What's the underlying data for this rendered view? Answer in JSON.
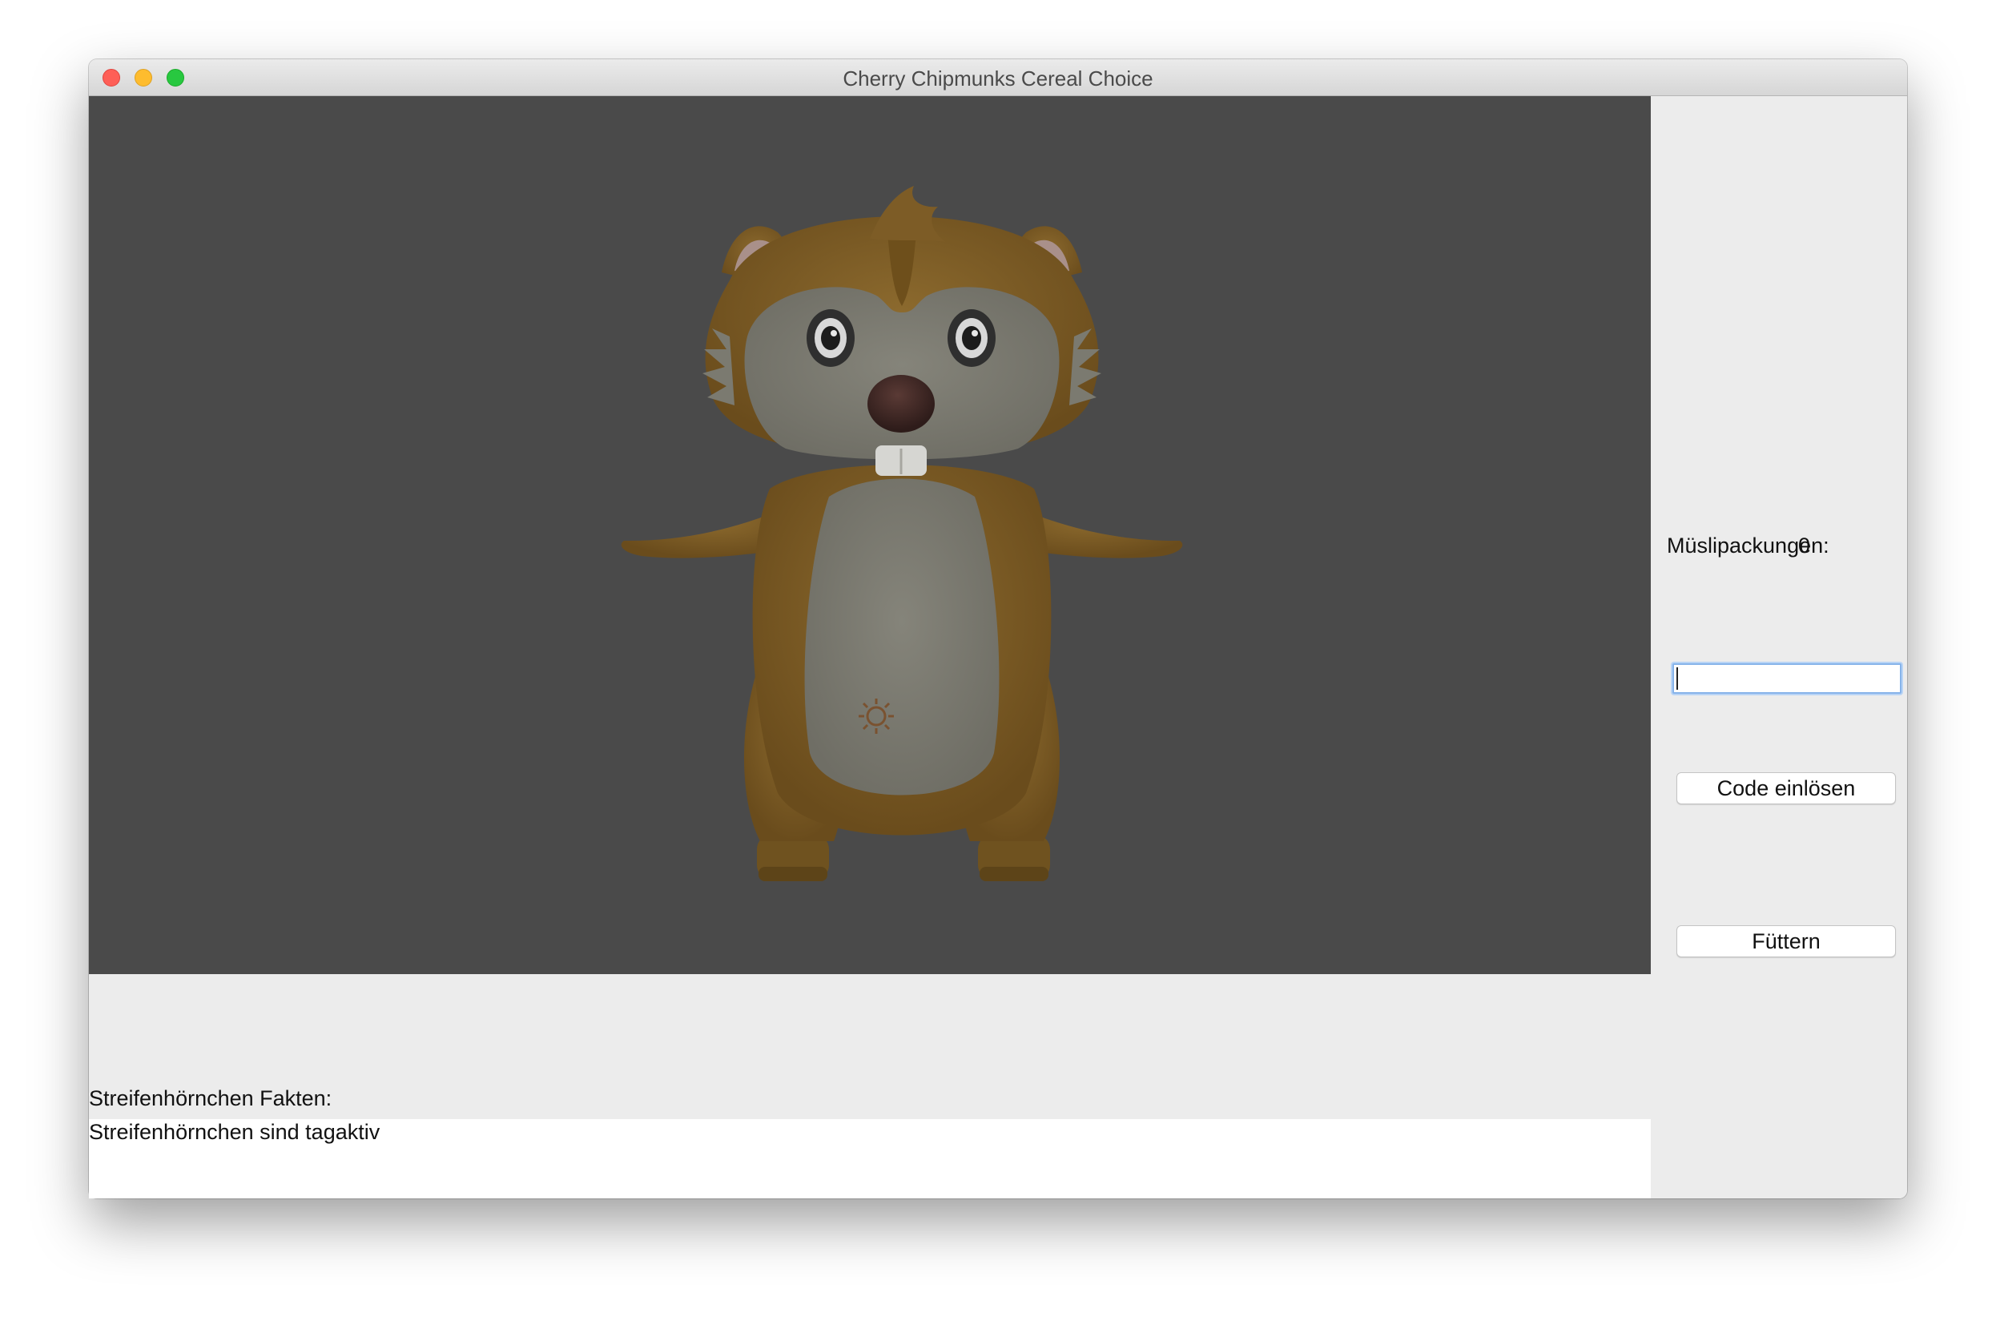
{
  "window": {
    "title": "Cherry Chipmunks Cereal Choice"
  },
  "sidebar": {
    "count_label": "Müslipackungen:",
    "count_value": "0",
    "code_input": {
      "value": "",
      "placeholder": ""
    },
    "redeem_button_label": "Code einlösen",
    "feed_button_label": "Füttern"
  },
  "facts": {
    "label": "Streifenhörnchen Fakten:",
    "text": "Streifenhörnchen sind tagaktiv"
  },
  "colors": {
    "viewport_background": "#4a4a4a",
    "fur": "#7d5c26",
    "belly": "#7b7a70",
    "window_background": "#ececec"
  },
  "icons": {
    "close": "close-icon",
    "minimize": "minimize-icon",
    "zoom": "zoom-icon"
  }
}
